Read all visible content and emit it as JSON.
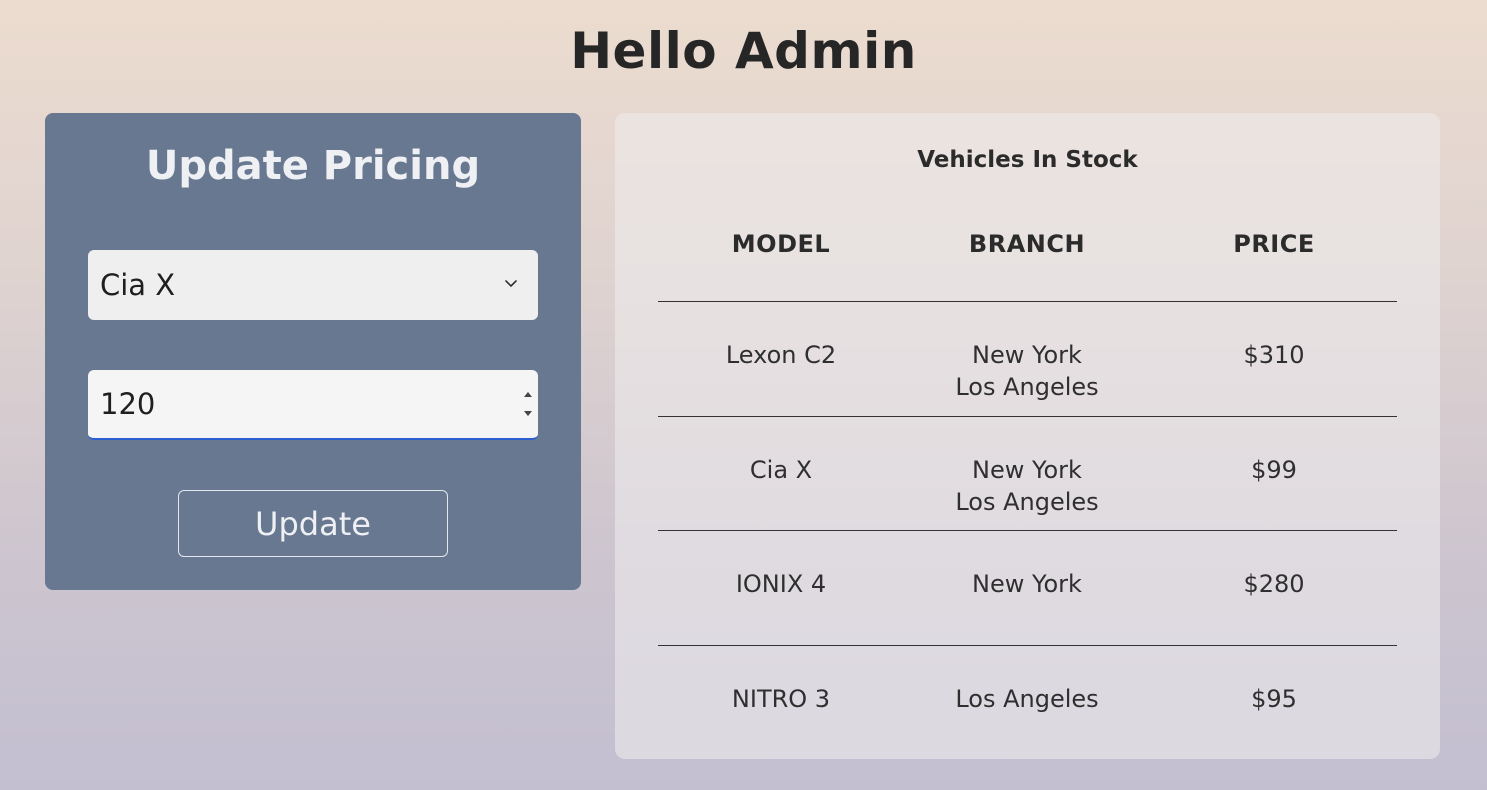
{
  "header": {
    "title": "Hello Admin"
  },
  "pricing_panel": {
    "title": "Update Pricing",
    "selected_model": "Cia X",
    "price_value": "120",
    "update_label": "Update"
  },
  "stock": {
    "title": "Vehicles In Stock",
    "columns": [
      "MODEL",
      "BRANCH",
      "PRICE"
    ],
    "rows": [
      {
        "model": "Lexon C2",
        "branches": [
          "New York",
          "Los Angeles"
        ],
        "price": "$310"
      },
      {
        "model": "Cia X",
        "branches": [
          "New York",
          "Los Angeles"
        ],
        "price": "$99"
      },
      {
        "model": "IONIX 4",
        "branches": [
          "New York"
        ],
        "price": "$280"
      },
      {
        "model": "NITRO 3",
        "branches": [
          "Los Angeles"
        ],
        "price": "$95"
      }
    ]
  },
  "colors": {
    "panel_bg": "#677890",
    "input_focus": "#2b5fd1"
  },
  "icons": {
    "select": "chevron-down-icon",
    "spinner": "spinner-arrows-icon"
  }
}
